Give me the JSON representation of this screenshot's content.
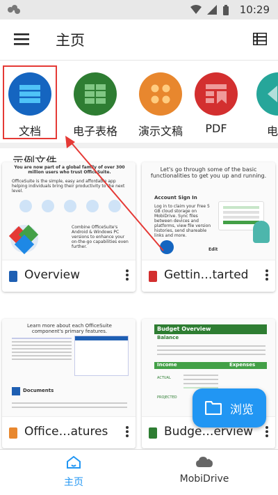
{
  "status": {
    "time": "10:29"
  },
  "header": {
    "title": "主页"
  },
  "categories": [
    {
      "label": "文档",
      "color": "#1565c0",
      "icon": "document-icon"
    },
    {
      "label": "电子表格",
      "color": "#2e7d32",
      "icon": "spreadsheet-icon"
    },
    {
      "label": "演示文稿",
      "color": "#e8872e",
      "icon": "presentation-icon"
    },
    {
      "label": "PDF",
      "color": "#d32f2f",
      "icon": "pdf-icon"
    },
    {
      "label": "电子",
      "color": "#26a69a",
      "icon": "ebook-icon"
    }
  ],
  "section": {
    "title": "示例文件"
  },
  "files": [
    {
      "name": "Overview",
      "type_color": "#1e5fb3",
      "thumb_title": "You are now part of a global family of over 300 million users who trust OfficeSuite.",
      "thumb_body": "OfficeSuite is the simple, easy and affordable app helping individuals bring their productivity to the next level.",
      "thumb_side": "Combine OfficeSuite's Android & Windows PC versions to enhance your on-the-go capabilities even further."
    },
    {
      "name": "Gettin…tarted",
      "type_color": "#d32f2f",
      "thumb_title": "Let's go through some of the basic functionalities to get you up and running.",
      "thumb_sub": "Account Sign In",
      "thumb_body": "Log in to claim your Free 5 GB cloud storage on MobiDrive. Sync files between devices and platforms, view file version histories, send shareable links and more.",
      "thumb_edit": "Edit"
    },
    {
      "name": "Office…atures",
      "type_color": "#e8872e",
      "thumb_title": "Learn more about each OfficeSuite component's primary features.",
      "thumb_sub": "Documents"
    },
    {
      "name": "Budge…erview",
      "type_color": "#2e7d32",
      "thumb_title": "Budget Overview",
      "thumb_sub1": "Balance",
      "thumb_income": "Income",
      "thumb_expenses": "Expenses",
      "thumb_actual": "ACTUAL",
      "thumb_projected": "PROJECTED"
    }
  ],
  "fab": {
    "label": "浏览"
  },
  "nav": [
    {
      "label": "主页",
      "active": true
    },
    {
      "label": "MobiDrive",
      "active": false
    }
  ]
}
